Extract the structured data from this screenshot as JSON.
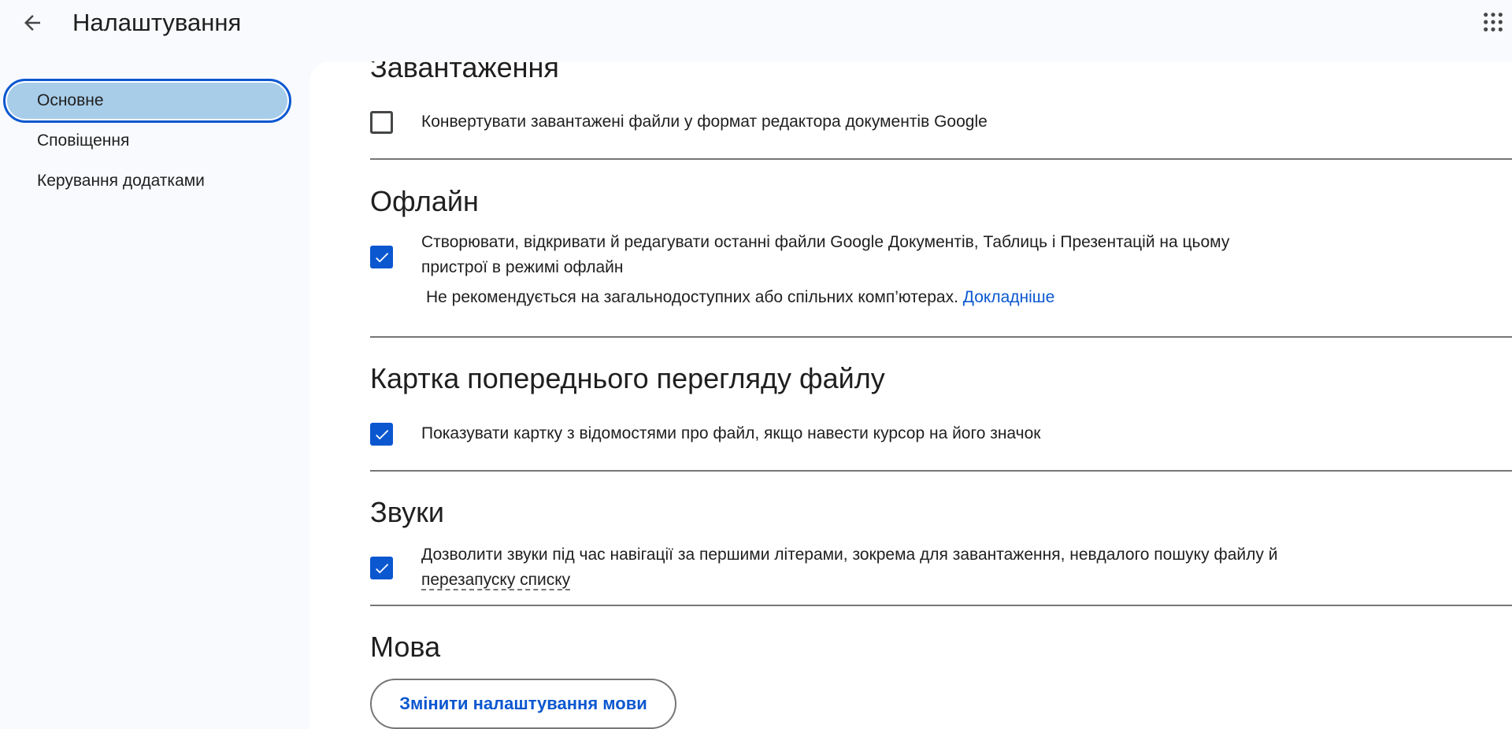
{
  "header": {
    "title": "Налаштування",
    "back_icon": "arrow-back-icon",
    "apps_icon": "apps-grid-icon"
  },
  "sidebar": {
    "items": [
      {
        "label": "Основне",
        "active": true
      },
      {
        "label": "Сповіщення",
        "active": false
      },
      {
        "label": "Керування додатками",
        "active": false
      }
    ]
  },
  "sections": {
    "uploads": {
      "title": "Завантаження",
      "option": "Конвертувати завантажені файли у формат редактора документів Google",
      "checked": false
    },
    "offline": {
      "title": "Офлайн",
      "option_line1": "Створювати, відкривати й редагувати останні файли Google Документів, Таблиць і Презентацій на цьому",
      "option_line2": "пристрої в режимі офлайн",
      "note": "Не рекомендується на загальнодоступних або спільних комп’ютерах.",
      "link": "Докладніше",
      "checked": true
    },
    "preview": {
      "title": "Картка попереднього перегляду файлу",
      "option": "Показувати картку з відомостями про файл, якщо навести курсор на його значок",
      "checked": true
    },
    "sounds": {
      "title": "Звуки",
      "option_line1": "Дозволити звуки під час навігації за першими літерами, зокрема для завантаження, невдалого пошуку файлу й",
      "option_line2": "перезапуску списку",
      "checked": true
    },
    "language": {
      "title": "Мова",
      "button": "Змінити налаштування мови"
    }
  },
  "colors": {
    "accent": "#0b57d0",
    "nav_active_bg": "#a8cde9",
    "page_bg": "#f8fafd",
    "card_bg": "#ffffff",
    "divider": "#747775"
  }
}
